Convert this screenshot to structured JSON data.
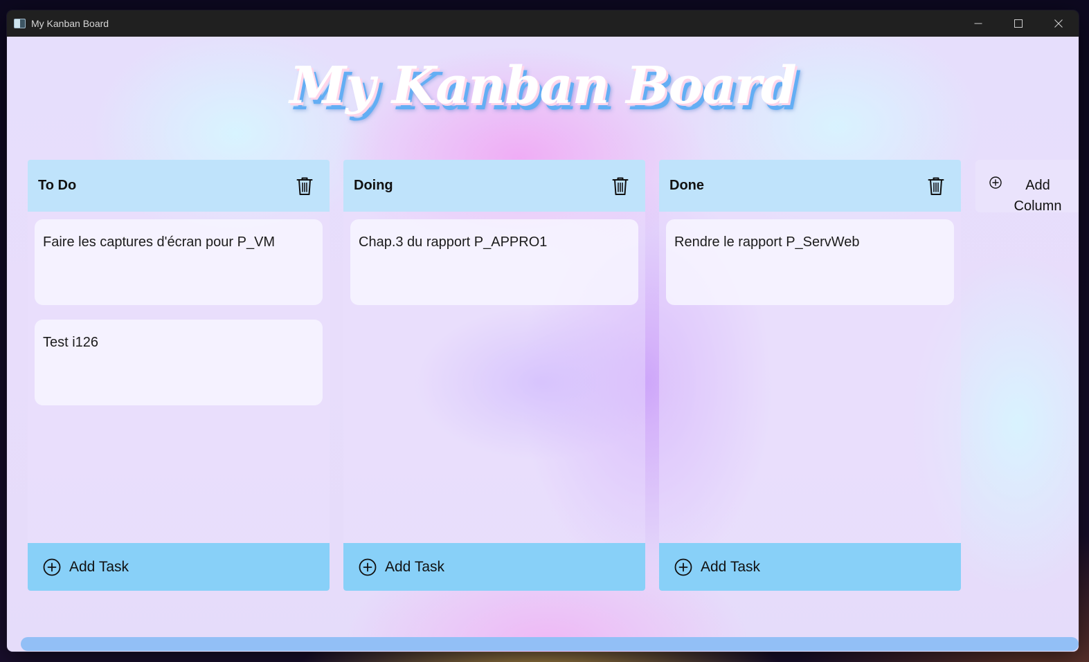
{
  "window": {
    "title": "My Kanban Board",
    "controls": [
      "minimize-icon",
      "maximize-icon",
      "close-icon"
    ]
  },
  "board": {
    "title": "My Kanban Board",
    "add_column_label": "Add Column",
    "columns": [
      {
        "title": "To Do",
        "tasks": [
          "Faire les captures d'écran pour P_VM",
          "Test i126"
        ],
        "add_task_label": "Add Task"
      },
      {
        "title": "Doing",
        "tasks": [
          "Chap.3 du rapport P_APPRO1"
        ],
        "add_task_label": "Add Task"
      },
      {
        "title": "Done",
        "tasks": [
          "Rendre le rapport P_ServWeb"
        ],
        "add_task_label": "Add Task"
      }
    ]
  },
  "colors": {
    "column_header": "#bfe3fb",
    "add_task_bar": "#88d0f8",
    "title_shadow": "#63aef4",
    "scrollbar": "#92bff6"
  }
}
